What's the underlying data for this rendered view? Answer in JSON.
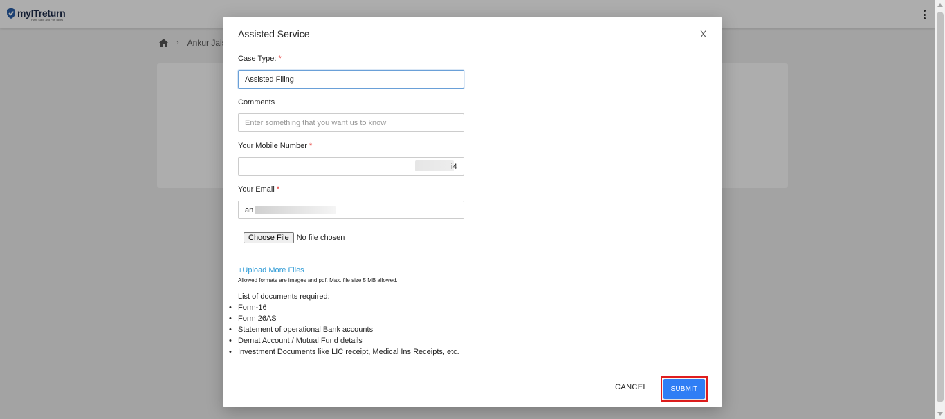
{
  "app": {
    "logo_text": "myITreturn",
    "logo_tagline": "Plan, Save and File Taxes"
  },
  "breadcrumb": {
    "current": "Ankur Jais"
  },
  "modal": {
    "title": "Assisted Service",
    "close_label": "X",
    "case_type": {
      "label": "Case Type:",
      "required_mark": "*",
      "value": "Assisted Filing"
    },
    "comments": {
      "label": "Comments",
      "placeholder": "Enter something that you want us to know",
      "value": ""
    },
    "mobile": {
      "label": "Your Mobile Number",
      "required_mark": "*",
      "visible_tail": "i4"
    },
    "email": {
      "label": "Your Email",
      "required_mark": "*",
      "visible_prefix": "an"
    },
    "file": {
      "button_label": "Choose File",
      "status": "No file chosen"
    },
    "upload_more_label": "+Upload More Files",
    "allowed_formats": "Allowed formats are images and pdf. Max. file size 5 MB allowed.",
    "documents_title": "List of documents required:",
    "documents": [
      "Form-16",
      "Form 26AS",
      "Statement of operational Bank accounts",
      "Demat Account / Mutual Fund details",
      "Investment Documents like LIC receipt, Medical Ins Receipts, etc."
    ],
    "cancel_label": "CANCEL",
    "submit_label": "SUBMIT"
  },
  "colors": {
    "accent": "#2f7ef5",
    "link": "#2e9bd6",
    "required": "#e53935",
    "highlight_outline": "#e01e1e"
  },
  "icons": {
    "logo": "shield-check-icon",
    "home": "home-icon",
    "separator": "chevron-right-icon",
    "menu": "kebab-menu-icon"
  }
}
